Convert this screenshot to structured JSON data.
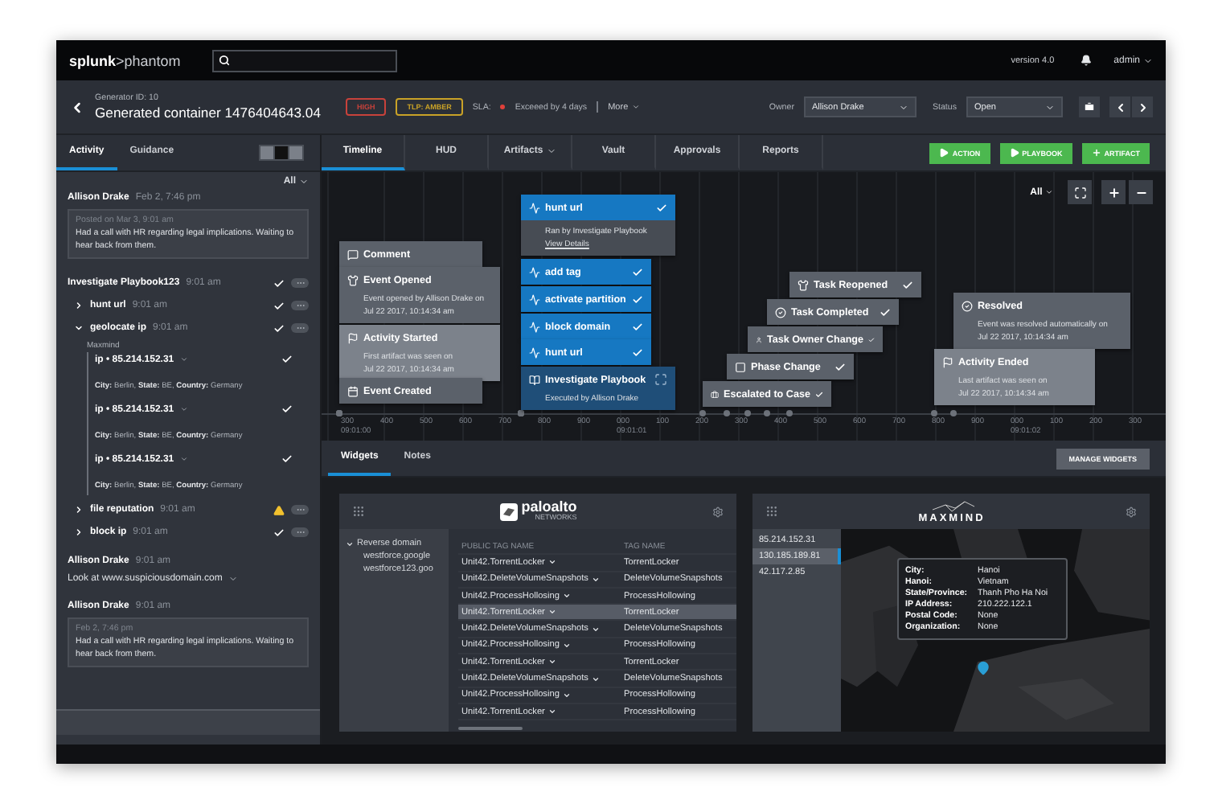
{
  "topbar": {
    "logo": "**splunk**>phantom",
    "version": "version 4.0",
    "user": "admin"
  },
  "header": {
    "generator": "Generator ID: 10",
    "title": "Generated container 1476404643.04",
    "severity": "HIGH",
    "tlp": "TLP: AMBER",
    "sla_label": "SLA:",
    "sla": "Exceeed by 4 days",
    "more": "More",
    "owner_label": "Owner",
    "owner": "Allison Drake",
    "status_label": "Status",
    "status": "Open"
  },
  "side_tabs": [
    {
      "label": "Activity",
      "selected": true
    },
    {
      "label": "Guidance",
      "selected": false
    }
  ],
  "view_toggle": [
    {
      "selected": false
    },
    {
      "selected": true
    },
    {
      "selected": false
    }
  ],
  "feed_filter": "All",
  "feed": [
    {
      "kind": "comment",
      "author": "Allison Drake",
      "time": "Feb 2, 7:46 pm",
      "note": {
        "meta": "Posted on Mar 3, 9:01 am",
        "text": "Had a call with HR regarding legal implications. Waiting to hear back from them."
      }
    },
    {
      "kind": "playbook",
      "name": "Investigate Playbook123",
      "time": "9:01 am",
      "checked": true,
      "actions": [
        {
          "name": "hunt url",
          "time": "9:01 am",
          "expanded": false,
          "checked": true,
          "warning": false
        },
        {
          "name": "geolocate ip",
          "time": "9:01 am",
          "expanded": true,
          "checked": true,
          "warning": false,
          "app": "Maxmind",
          "results": [
            {
              "ip": "ip • 85.214.152.31",
              "checked": true,
              "detail": "**City:** Berlin, **State:** BE, **Country:** Germany"
            },
            {
              "ip": "ip • 85.214.152.31",
              "checked": true,
              "detail": "**City:** Berlin, **State:** BE, **Country:** Germany"
            },
            {
              "ip": "ip • 85.214.152.31",
              "checked": true,
              "detail": "**City:** Berlin, **State:** BE, **Country:** Germany"
            }
          ]
        },
        {
          "name": "file reputation",
          "time": "9:01 am",
          "expanded": false,
          "checked": false,
          "warning": true
        },
        {
          "name": "block ip",
          "time": "9:01 am",
          "expanded": false,
          "checked": true,
          "warning": false
        }
      ]
    },
    {
      "kind": "message",
      "author": "Allison Drake",
      "time": "9:01 am",
      "text": "Look at www.suspiciousdomain.com"
    },
    {
      "kind": "comment",
      "author": "Allison Drake",
      "time": "9:01 am",
      "note": {
        "meta": "Feb 2, 7:46 pm",
        "text": "Had a call with HR regarding legal implications. Waiting to hear back from them."
      }
    }
  ],
  "main_tabs": [
    {
      "label": "Timeline",
      "selected": true,
      "menu": false
    },
    {
      "label": "HUD",
      "selected": false,
      "menu": false
    },
    {
      "label": "Artifacts",
      "selected": false,
      "menu": true
    },
    {
      "label": "Vault",
      "selected": false,
      "menu": false
    },
    {
      "label": "Approvals",
      "selected": false,
      "menu": false
    },
    {
      "label": "Reports",
      "selected": false,
      "menu": false
    }
  ],
  "actions": [
    {
      "label": "ACTION",
      "kind": "run"
    },
    {
      "label": "PLAYBOOK",
      "kind": "run"
    },
    {
      "label": "ARTIFACT",
      "kind": "add"
    }
  ],
  "timeline": {
    "filter": "All",
    "events": [
      {
        "kind": "event",
        "title": "Comment",
        "checked": false
      },
      {
        "kind": "event",
        "title": "Event Opened",
        "checked": false,
        "details": [
          "Event opened by Allison Drake on",
          "Jul 22 2017, 10:14:34 am"
        ]
      },
      {
        "kind": "milestone",
        "title": "Activity Started",
        "checked": false,
        "details": [
          "First artifact was seen on",
          "Jul 22 2017, 10:14:34 am"
        ]
      },
      {
        "kind": "event",
        "title": "Event Created",
        "checked": false
      },
      {
        "kind": "action",
        "title": "hunt url",
        "checked": true,
        "details": [
          "Ran by Investigate Playbook"
        ],
        "link": "View Details"
      },
      {
        "kind": "action",
        "title": "add tag",
        "checked": true
      },
      {
        "kind": "action",
        "title": "activate partition",
        "checked": true
      },
      {
        "kind": "action",
        "title": "block domain",
        "checked": true
      },
      {
        "kind": "action",
        "title": "hunt url",
        "checked": true
      },
      {
        "kind": "playbook",
        "title": "Investigate Playbook",
        "checked": false,
        "details": [
          "Executed by Allison Drake"
        ]
      },
      {
        "kind": "event",
        "title": "Task Reopened",
        "checked": true
      },
      {
        "kind": "event",
        "title": "Task Completed",
        "checked": true
      },
      {
        "kind": "event",
        "title": "Task Owner Change",
        "checked": true
      },
      {
        "kind": "event",
        "title": "Phase Change",
        "checked": true
      },
      {
        "kind": "event",
        "title": "Escalated to Case",
        "checked": true
      },
      {
        "kind": "event",
        "title": "Resolved",
        "checked": false,
        "details": [
          "Event was resolved automatically on",
          "Jul 22 2017, 10:14:34 am"
        ]
      },
      {
        "kind": "milestone",
        "title": "Activity Ended",
        "checked": false,
        "details": [
          "Last artifact was seen on",
          "Jul 22 2017, 10:14:34 am"
        ]
      }
    ],
    "ticks": [
      {
        "label": "300",
        "sub": "09:01:00"
      },
      {
        "label": "400"
      },
      {
        "label": "500"
      },
      {
        "label": "600"
      },
      {
        "label": "700"
      },
      {
        "label": "800"
      },
      {
        "label": "900"
      },
      {
        "label": "000",
        "sub": "09:01:01"
      },
      {
        "label": "100"
      },
      {
        "label": "200"
      },
      {
        "label": "300"
      },
      {
        "label": "400"
      },
      {
        "label": "500"
      },
      {
        "label": "600"
      },
      {
        "label": "700"
      },
      {
        "label": "800"
      },
      {
        "label": "900"
      },
      {
        "label": "000",
        "sub": "09:01:02"
      },
      {
        "label": "100"
      },
      {
        "label": "200"
      },
      {
        "label": "300"
      }
    ]
  },
  "widget_tabs": [
    {
      "label": "Widgets",
      "selected": true
    },
    {
      "label": "Notes",
      "selected": false
    }
  ],
  "manage": "MANAGE WIDGETS",
  "paloalto": {
    "logo": "paloalto",
    "sub": "NETWORKS",
    "tree": [
      {
        "label": "Reverse domain",
        "expanded": true,
        "children": [
          {
            "label": "westforce.google"
          },
          {
            "label": "westforce123.goo"
          }
        ]
      }
    ],
    "columns": [
      "PUBLIC TAG NAME",
      "TAG NAME"
    ],
    "rows": [
      {
        "public": "Unit42.TorrentLocker",
        "tag": "TorrentLocker",
        "selected": false
      },
      {
        "public": "Unit42.DeleteVolumeSnapshots",
        "tag": "DeleteVolumeSnapshots",
        "selected": false
      },
      {
        "public": "Unit42.ProcessHollosing",
        "tag": "ProcessHollowing",
        "selected": false
      },
      {
        "public": "Unit42.TorrentLocker",
        "tag": "TorrentLocker",
        "selected": true
      },
      {
        "public": "Unit42.DeleteVolumeSnapshots",
        "tag": "DeleteVolumeSnapshots",
        "selected": false
      },
      {
        "public": "Unit42.ProcessHollosing",
        "tag": "ProcessHollowing",
        "selected": false
      },
      {
        "public": "Unit42.TorrentLocker",
        "tag": "TorrentLocker",
        "selected": false
      },
      {
        "public": "Unit42.DeleteVolumeSnapshots",
        "tag": "DeleteVolumeSnapshots",
        "selected": false
      },
      {
        "public": "Unit42.ProcessHollosing",
        "tag": "ProcessHollowing",
        "selected": false
      },
      {
        "public": "Unit42.TorrentLocker",
        "tag": "ProcessHollowing",
        "selected": false
      }
    ]
  },
  "maxmind": {
    "logo": "MAXMIND",
    "ips": [
      {
        "label": "85.214.152.31",
        "selected": false
      },
      {
        "label": "130.185.189.81",
        "selected": true
      },
      {
        "label": "42.117.2.85",
        "selected": false
      }
    ],
    "popup": [
      {
        "label": "City:",
        "value": "Hanoi"
      },
      {
        "label": "Hanoi:",
        "value": "Vietnam"
      },
      {
        "label": "State/Province:",
        "value": "Thanh Pho Ha Noi"
      },
      {
        "label": "IP Address:",
        "value": "210.222.122.1"
      },
      {
        "label": "Postal Code:",
        "value": "None"
      },
      {
        "label": "Organization:",
        "value": "None"
      }
    ]
  }
}
